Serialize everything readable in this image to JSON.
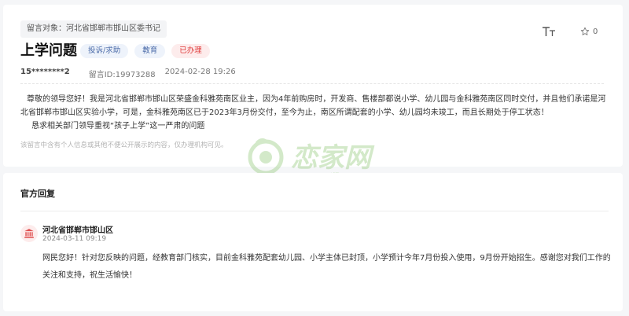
{
  "message": {
    "target_label": "留言对象：河北省邯郸市邯山区委书记",
    "title": "上学问题",
    "tags": [
      "投诉/求助",
      "教育",
      "已办理"
    ],
    "author": "15********2",
    "message_id": "留言ID:19973288",
    "datetime": "2024-02-28 19:26",
    "star_count": "0",
    "body_p1": "尊敬的领导您好！我是河北省邯郸市邯山区荣盛金科雅苑南区业主，因为4年前购房时，开发商、售楼部都说小学、幼儿园与金科雅苑南区同时交付，并且他们承诺是河北省邯郸市邯山区实验小学，可是，金科雅苑南区已于2023年3月份交付，至今为止，南区所谓配套的小学、幼儿园均未竣工，而且长期处于停工状态！",
    "body_p2": "恳求相关部门领导重视“孩子上学”这一严肃的问题",
    "privacy_note": "该留言中含有个人信息或其他不便公开展示的内容，仅办理机构可见。"
  },
  "watermark_text": "恋家网",
  "watermark_url": "www.tjlj.com",
  "reply": {
    "section_title": "官方回复",
    "org_name": "河北省邯郸市邯山区",
    "date": "2024-03-11 09:19",
    "text": "网民您好！针对您反映的问题，经教育部门核实，目前金科雅苑配套幼儿园、小学主体已封顶，小学预计今年7月份投入使用，9月份开始招生。感谢您对我们工作的关注和支持，祝生活愉快！"
  },
  "icons": {
    "text_size": "text-size-icon",
    "star": "star-icon",
    "org": "government-building-icon"
  },
  "colors": {
    "resolved_tag": "#e03c3c",
    "category_tag": "#4a6aa8",
    "watermark": "#9fd08a"
  }
}
